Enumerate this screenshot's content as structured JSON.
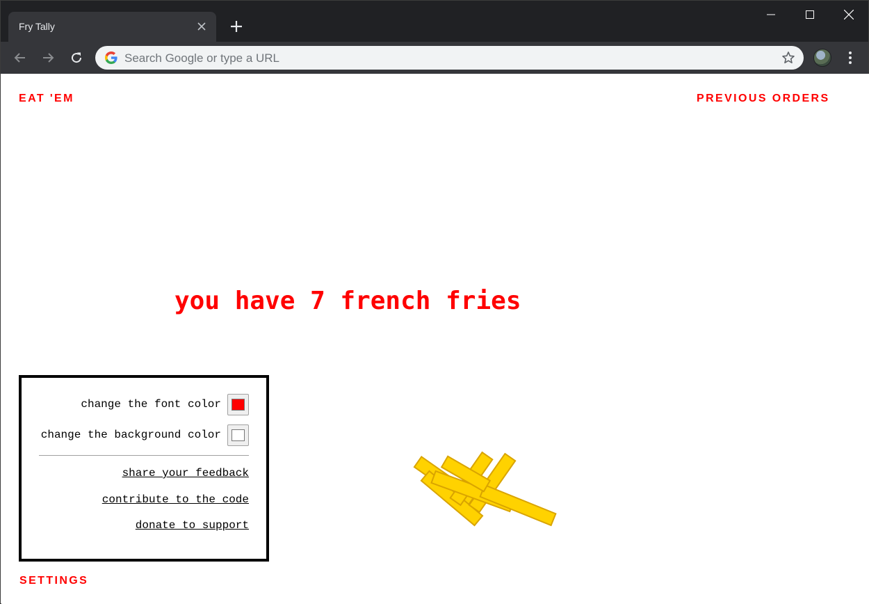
{
  "browser": {
    "tab_title": "Fry Tally",
    "omnibox_placeholder": "Search Google or type a URL"
  },
  "nav": {
    "eat_label": "EAT 'EM",
    "previous_orders_label": "PREVIOUS ORDERS"
  },
  "main": {
    "headline": "you have 7 french fries",
    "fry_count": 7
  },
  "settings": {
    "font_color_label": "change the font color",
    "font_color": "#ff0000",
    "background_color_label": "change the background color",
    "background_color": "#ffffff",
    "links": {
      "feedback": "share your feedback",
      "code": "contribute to the code",
      "donate": "donate to support"
    },
    "toggle_label": "SETTINGS"
  },
  "icons": {
    "tab_close": "close-icon",
    "new_tab": "plus-icon",
    "back": "arrow-left-icon",
    "forward": "arrow-right-icon",
    "reload": "reload-icon",
    "google": "google-g-icon",
    "bookmark": "star-icon",
    "menu": "more-vert-icon"
  },
  "colors": {
    "accent": "#ff0000",
    "fry_fill": "#ffd200",
    "fry_stroke": "#d9a400"
  }
}
